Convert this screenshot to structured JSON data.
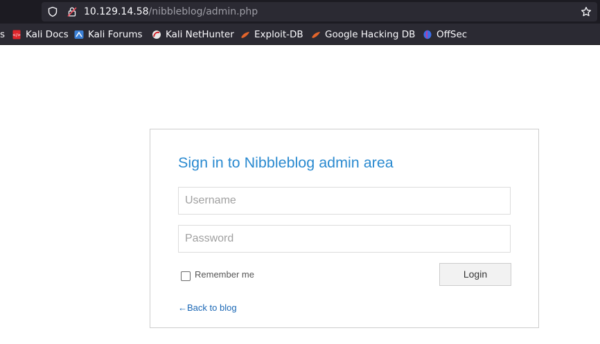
{
  "browser": {
    "url": {
      "host": "10.129.14.58",
      "path": "/nibbleblog/admin.php"
    },
    "bookmarks": [
      {
        "label": "s",
        "icon": "kali-tools-icon"
      },
      {
        "label": "Kali Docs",
        "icon": "kali-docs-icon"
      },
      {
        "label": "Kali Forums",
        "icon": "kali-forums-icon"
      },
      {
        "label": "Kali NetHunter",
        "icon": "kali-nethunter-icon"
      },
      {
        "label": "Exploit-DB",
        "icon": "exploit-db-icon"
      },
      {
        "label": "Google Hacking DB",
        "icon": "ghdb-icon"
      },
      {
        "label": "OffSec",
        "icon": "offsec-icon"
      }
    ]
  },
  "login": {
    "title": "Sign in to Nibbleblog admin area",
    "username_placeholder": "Username",
    "password_placeholder": "Password",
    "remember_label": "Remember me",
    "remember_checked": false,
    "login_label": "Login",
    "back_link": "←Back to blog"
  },
  "colors": {
    "accent": "#2a8ad0",
    "link": "#1a67b5",
    "chrome_bg": "#1c1b22",
    "toolbar_bg": "#2b2a33"
  }
}
